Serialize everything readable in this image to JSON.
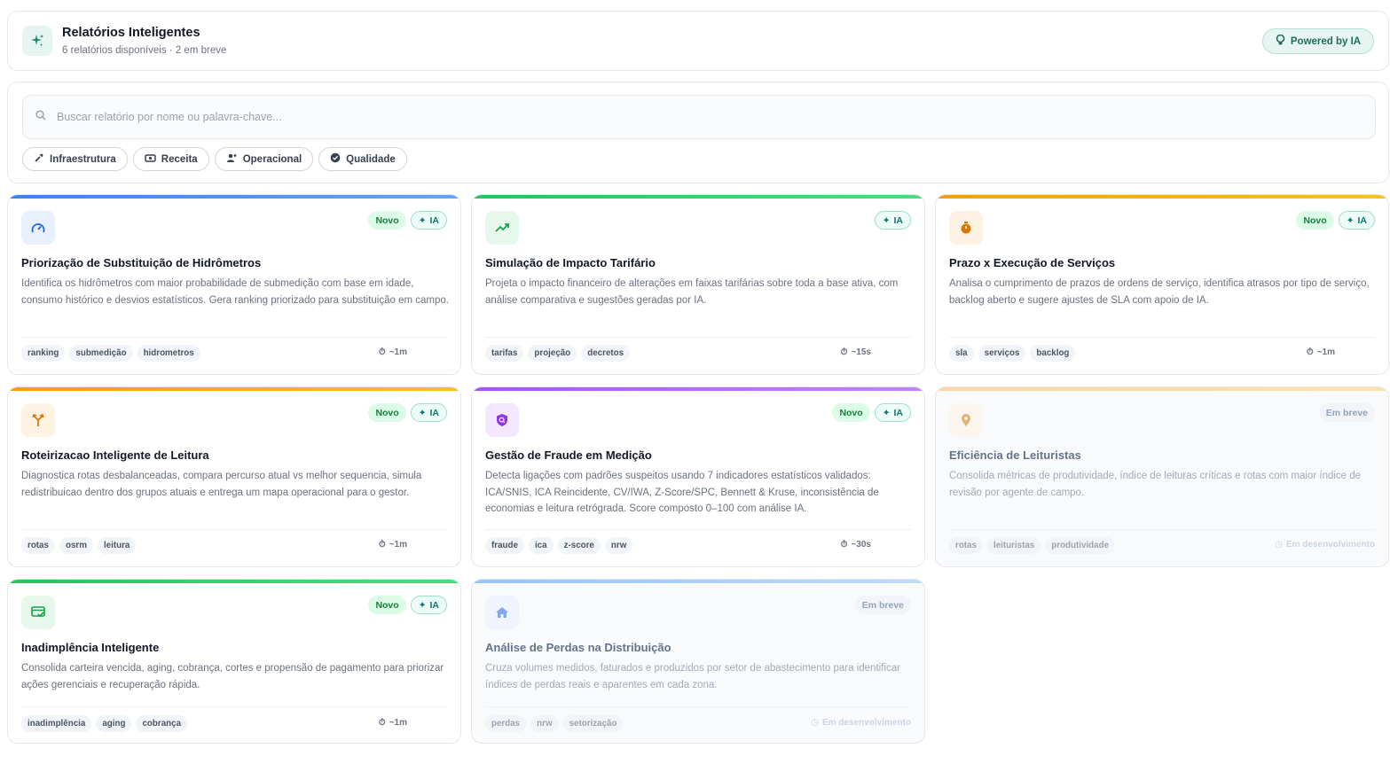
{
  "header": {
    "title": "Relatórios Inteligentes",
    "subtitle": "6 relatórios disponíveis · 2 em breve",
    "powered": "Powered by IA"
  },
  "search": {
    "placeholder": "Buscar relatório por nome ou palavra-chave..."
  },
  "chips": [
    {
      "label": "Infraestrutura",
      "icon": "wrench-icon"
    },
    {
      "label": "Receita",
      "icon": "money-icon"
    },
    {
      "label": "Operacional",
      "icon": "users-icon"
    },
    {
      "label": "Qualidade",
      "icon": "verified-badge-icon"
    }
  ],
  "badges": {
    "novo": "Novo",
    "ia": "IA",
    "breve": "Em breve",
    "dev": "Em desenvolvimento"
  },
  "colors": {
    "accent": "#1e6f5a",
    "blue": "#3b82f6",
    "green": "#22c55e",
    "orange": "#f59e0b",
    "purple": "#a855f7"
  },
  "cards": [
    {
      "title": "Priorização de Substituição de Hidrômetros",
      "desc": "Identifica os hidrômetros com maior probabilidade de submedição com base em idade, consumo histórico e desvios estatísticos. Gera ranking priorizado para substituição em campo.",
      "tags": [
        "ranking",
        "submedição",
        "hidrometros"
      ],
      "time": "~1m",
      "icon": "gauge-icon"
    },
    {
      "title": "Simulação de Impacto Tarifário",
      "desc": "Projeta o impacto financeiro de alterações em faixas tarifárias sobre toda a base ativa, com análise comparativa e sugestões geradas por IA.",
      "tags": [
        "tarifas",
        "projeção",
        "decretos"
      ],
      "time": "~15s",
      "icon": "trending-up-icon"
    },
    {
      "title": "Prazo x Execução de Serviços",
      "desc": "Analisa o cumprimento de prazos de ordens de serviço, identifica atrasos por tipo de serviço, backlog aberto e sugere ajustes de SLA com apoio de IA.",
      "tags": [
        "sla",
        "serviços",
        "backlog"
      ],
      "time": "~1m",
      "icon": "stopwatch-icon"
    },
    {
      "title": "Roteirizacao Inteligente de Leitura",
      "desc": "Diagnostica rotas desbalanceadas, compara percurso atual vs melhor sequencia, simula redistribuicao dentro dos grupos atuais e entrega um mapa operacional para o gestor.",
      "tags": [
        "rotas",
        "osrm",
        "leitura"
      ],
      "time": "~1m",
      "icon": "route-fork-icon"
    },
    {
      "title": "Gestão de Fraude em Medição",
      "desc": "Detecta ligações com padrões suspeitos usando 7 indicadores estatísticos validados: ICA/SNIS, ICA Reincidente, CV/IWA, Z-Score/SPC, Bennett & Kruse, inconsistência de economias e leitura retrógrada. Score composto 0–100 com análise IA.",
      "tags": [
        "fraude",
        "ica",
        "z-score",
        "nrw"
      ],
      "time": "~30s",
      "icon": "shield-search-icon"
    },
    {
      "title": "Eficiência de Leituristas",
      "desc": "Consolida métricas de produtividade, índice de leituras críticas e rotas com maior índice de revisão por agente de campo.",
      "tags": [
        "rotas",
        "leituristas",
        "produtividade"
      ],
      "icon": "map-pin-icon"
    },
    {
      "title": "Inadimplência Inteligente",
      "desc": "Consolida carteira vencida, aging, cobrança, cortes e propensão de pagamento para priorizar ações gerenciais e recuperação rápida.",
      "tags": [
        "inadimplência",
        "aging",
        "cobrança"
      ],
      "time": "~1m",
      "icon": "card-check-icon"
    },
    {
      "title": "Análise de Perdas na Distribuição",
      "desc": "Cruza volumes medidos, faturados e produzidos por setor de abastecimento para identificar índices de perdas reais e aparentes em cada zona.",
      "tags": [
        "perdas",
        "nrw",
        "setorização"
      ],
      "icon": "home-icon"
    }
  ]
}
